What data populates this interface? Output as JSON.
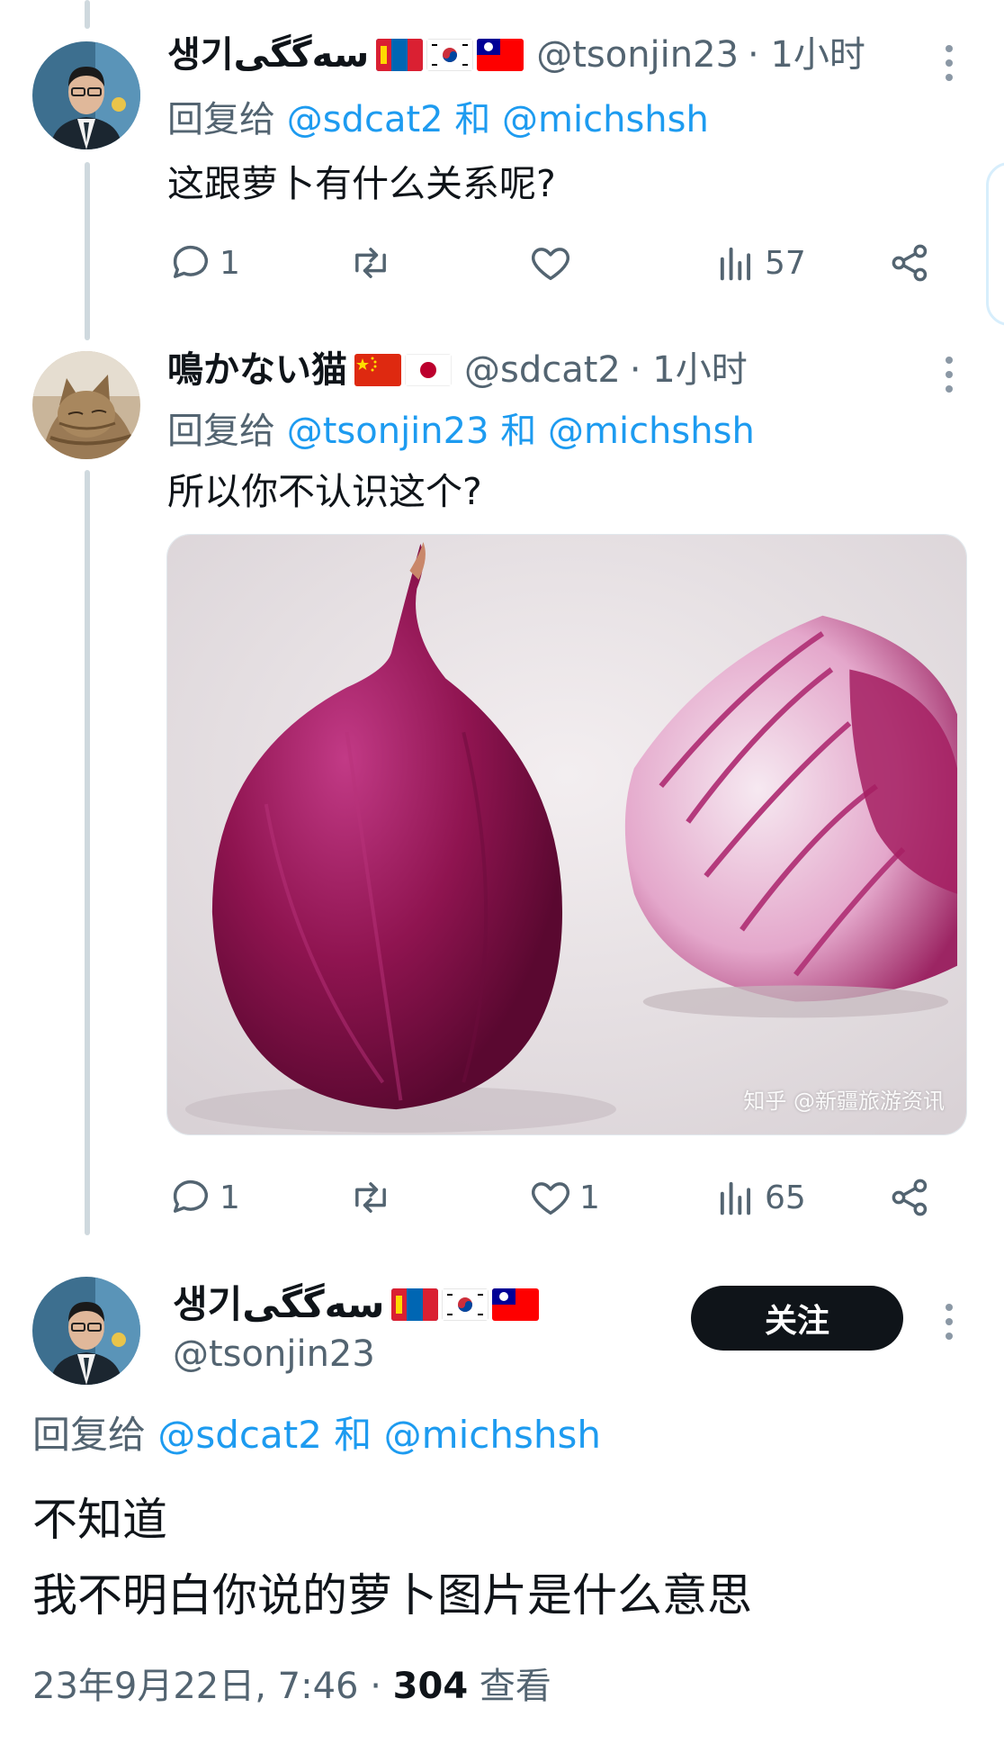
{
  "tweet1": {
    "name": "생기سەگگی",
    "flags": [
      "mongolia-flag",
      "south-korea-flag",
      "taiwan-flag"
    ],
    "handle": "@tsonjin23",
    "time": "· 1小时",
    "reply_prefix": "回复给",
    "reply_user1": "@sdcat2",
    "reply_and": "和",
    "reply_user2": "@michshsh",
    "text": "这跟萝卜有什么关系呢?",
    "replies": "1",
    "retweets": "",
    "likes": "",
    "views": "57"
  },
  "tweet2": {
    "name": "鳴かない猫",
    "flags": [
      "china-flag",
      "japan-flag"
    ],
    "handle": "@sdcat2",
    "time": "· 1小时",
    "reply_prefix": "回复给",
    "reply_user1": "@tsonjin23",
    "reply_and": "和",
    "reply_user2": "@michshsh",
    "text": "所以你不认识这个?",
    "image_watermark": "知乎 @新疆旅游资讯",
    "replies": "1",
    "retweets": "",
    "likes": "1",
    "views": "65"
  },
  "main_tweet": {
    "name": "생기سەگگی",
    "flags": [
      "mongolia-flag",
      "south-korea-flag",
      "taiwan-flag"
    ],
    "handle": "@tsonjin23",
    "follow_label": "关注",
    "reply_prefix": "回复给",
    "reply_user1": "@sdcat2",
    "reply_and": "和",
    "reply_user2": "@michshsh",
    "text_line1": "不知道",
    "text_line2": "我不明白你说的萝卜图片是什么意思",
    "date": "23年9月22日, 7:46 ·",
    "views_count": "304",
    "views_label": "查看"
  },
  "colors": {
    "link": "#1d9bf0",
    "muted": "#536471",
    "text": "#0f1419",
    "thread_line": "#cfd9de",
    "follow_bg": "#0f1419"
  }
}
